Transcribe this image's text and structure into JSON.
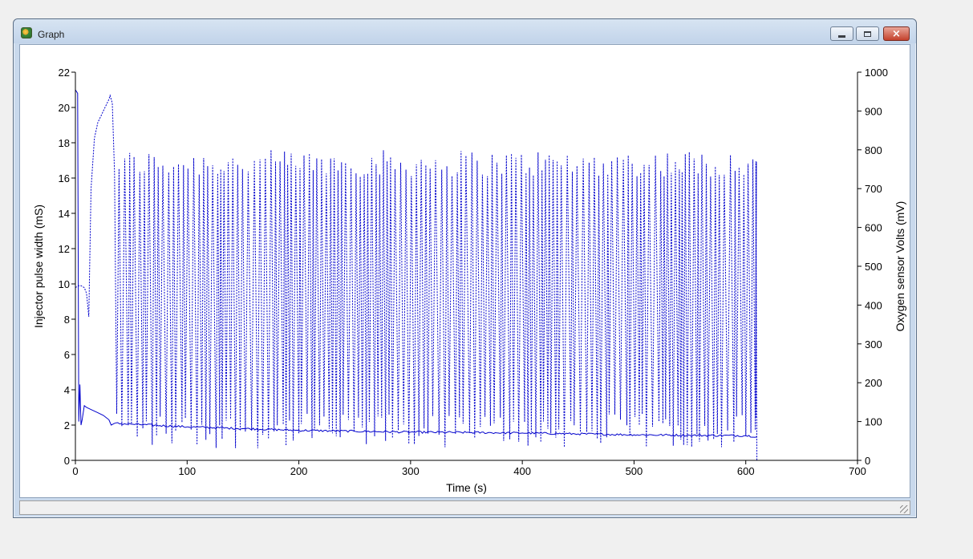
{
  "window": {
    "title": "Graph",
    "app_icon": "graph-app-icon",
    "buttons": {
      "minimize": "minimize-icon",
      "maximize": "maximize-icon",
      "close": "close-icon",
      "close_glyph": "×"
    }
  },
  "colors": {
    "series": "#0000cc",
    "axis": "#000000",
    "window_frame": "#c9d9ec"
  },
  "chart_data": {
    "type": "line",
    "title": "",
    "xlabel": "Time (s)",
    "ylabel_left": "Injector pulse width (mS)",
    "ylabel_right": "Oxygen sensor Volts (mV)",
    "xlim": [
      0,
      700
    ],
    "ylim_left": [
      0,
      22
    ],
    "ylim_right": [
      0,
      1000
    ],
    "x_ticks": [
      0,
      100,
      200,
      300,
      400,
      500,
      600,
      700
    ],
    "y_left_ticks": [
      0,
      2,
      4,
      6,
      8,
      10,
      12,
      14,
      16,
      18,
      20,
      22
    ],
    "y_right_ticks": [
      0,
      100,
      200,
      300,
      400,
      500,
      600,
      700,
      800,
      900,
      1000
    ],
    "grid": false,
    "legend": "none",
    "series": [
      {
        "axis": "left",
        "style": "solid",
        "x": [
          0,
          2,
          3,
          4,
          5,
          6,
          8,
          10,
          15,
          20,
          25,
          30,
          32,
          35,
          50,
          100,
          150,
          200,
          250,
          300,
          350,
          400,
          450,
          500,
          550,
          600,
          610
        ],
        "y": [
          21,
          20.8,
          2.2,
          4.3,
          2.0,
          2.3,
          3.1,
          3.0,
          2.85,
          2.7,
          2.55,
          2.3,
          2.0,
          2.1,
          2.05,
          1.9,
          1.8,
          1.7,
          1.65,
          1.6,
          1.58,
          1.55,
          1.5,
          1.45,
          1.42,
          1.4,
          1.35
        ]
      },
      {
        "axis": "right",
        "style": "dotted",
        "x": [
          0,
          3,
          5,
          8,
          10,
          12,
          14,
          17,
          20,
          25,
          30,
          31,
          33,
          35,
          37,
          610
        ],
        "y": [
          445,
          450,
          450,
          445,
          430,
          370,
          700,
          830,
          870,
          900,
          930,
          940,
          920,
          740,
          120,
          0
        ],
        "oscillation": {
          "x_start": 37,
          "x_end": 610,
          "peak_min": 730,
          "peak_max": 800,
          "trough_min": 30,
          "trough_max": 120,
          "approx_cycle_s": 4
        }
      }
    ]
  }
}
